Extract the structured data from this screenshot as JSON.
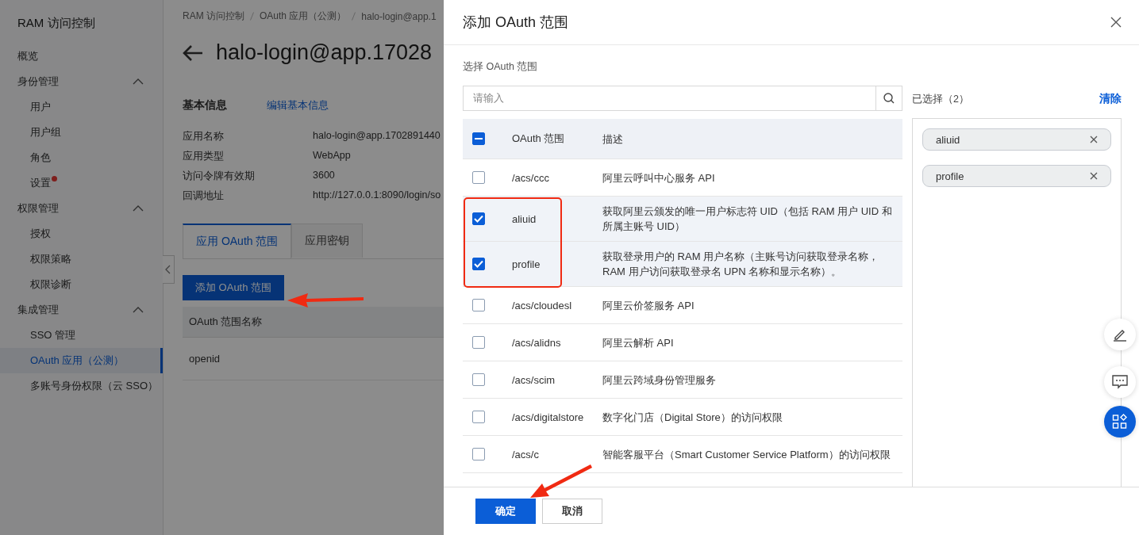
{
  "sidebar": {
    "title": "RAM 访问控制",
    "items": [
      {
        "label": "概览",
        "kind": "link",
        "selected": false
      },
      {
        "label": "身份管理",
        "kind": "group",
        "expanded": true,
        "children": [
          {
            "label": "用户",
            "selected": false,
            "notify": false
          },
          {
            "label": "用户组",
            "selected": false,
            "notify": false
          },
          {
            "label": "角色",
            "selected": false,
            "notify": false
          },
          {
            "label": "设置",
            "selected": false,
            "notify": true
          }
        ]
      },
      {
        "label": "权限管理",
        "kind": "group",
        "expanded": true,
        "children": [
          {
            "label": "授权",
            "selected": false,
            "notify": false
          },
          {
            "label": "权限策略",
            "selected": false,
            "notify": false
          },
          {
            "label": "权限诊断",
            "selected": false,
            "notify": false
          }
        ]
      },
      {
        "label": "集成管理",
        "kind": "group",
        "expanded": true,
        "children": [
          {
            "label": "SSO 管理",
            "selected": false,
            "notify": false
          },
          {
            "label": "OAuth 应用（公测）",
            "selected": true,
            "notify": false
          },
          {
            "label": "多账号身份权限（云 SSO）",
            "selected": false,
            "notify": false
          }
        ]
      }
    ]
  },
  "main": {
    "breadcrumb": [
      "RAM 访问控制",
      "OAuth 应用（公测）",
      "halo-login@app.1"
    ],
    "title": "halo-login@app.17028",
    "section_title": "基本信息",
    "edit_link": "编辑基本信息",
    "fields": [
      {
        "label": "应用名称",
        "value": "halo-login@app.1702891440"
      },
      {
        "label": "应用类型",
        "value": "WebApp"
      },
      {
        "label": "访问令牌有效期",
        "value": "3600"
      },
      {
        "label": "回调地址",
        "value": "http://127.0.0.1:8090/login/so"
      }
    ],
    "tabs": [
      {
        "label": "应用 OAuth 范围",
        "selected": true
      },
      {
        "label": "应用密钥",
        "selected": false
      }
    ],
    "add_button": "添加 OAuth 范围",
    "table": {
      "columns": [
        "OAuth 范围名称"
      ],
      "rows": [
        [
          "openid"
        ]
      ]
    }
  },
  "drawer": {
    "title": "添加 OAuth 范围",
    "section_label": "选择 OAuth 范围",
    "search": {
      "placeholder": "请输入"
    },
    "columns": [
      "OAuth 范围",
      "描述"
    ],
    "select_all": {
      "checked": true,
      "partial": true
    },
    "rows": [
      {
        "scope": "/acs/ccc",
        "description": "阿里云呼叫中心服务 API",
        "checked": false
      },
      {
        "scope": "aliuid",
        "description": "获取阿里云颁发的唯一用户标志符 UID（包括 RAM 用户 UID 和所属主账号 UID）",
        "checked": true
      },
      {
        "scope": "profile",
        "description": "获取登录用户的 RAM 用户名称（主账号访问获取登录名称，RAM 用户访问获取登录名 UPN 名称和显示名称）。",
        "checked": true
      },
      {
        "scope": "/acs/cloudesl",
        "description": "阿里云价签服务 API",
        "checked": false
      },
      {
        "scope": "/acs/alidns",
        "description": "阿里云解析 API",
        "checked": false
      },
      {
        "scope": "/acs/scim",
        "description": "阿里云跨域身份管理服务",
        "checked": false
      },
      {
        "scope": "/acs/digitalstore",
        "description": "数字化门店（Digital Store）的访问权限",
        "checked": false
      },
      {
        "scope": "/acs/c",
        "description": "智能客服平台（Smart Customer Service Platform）的访问权限",
        "checked": false
      }
    ],
    "selected_label": "已选择（2）",
    "clear": "清除",
    "tags": [
      "aliuid",
      "profile"
    ],
    "buttons": [
      {
        "label": "确定",
        "kind": "primary"
      },
      {
        "label": "取消",
        "kind": "secondary"
      }
    ]
  }
}
